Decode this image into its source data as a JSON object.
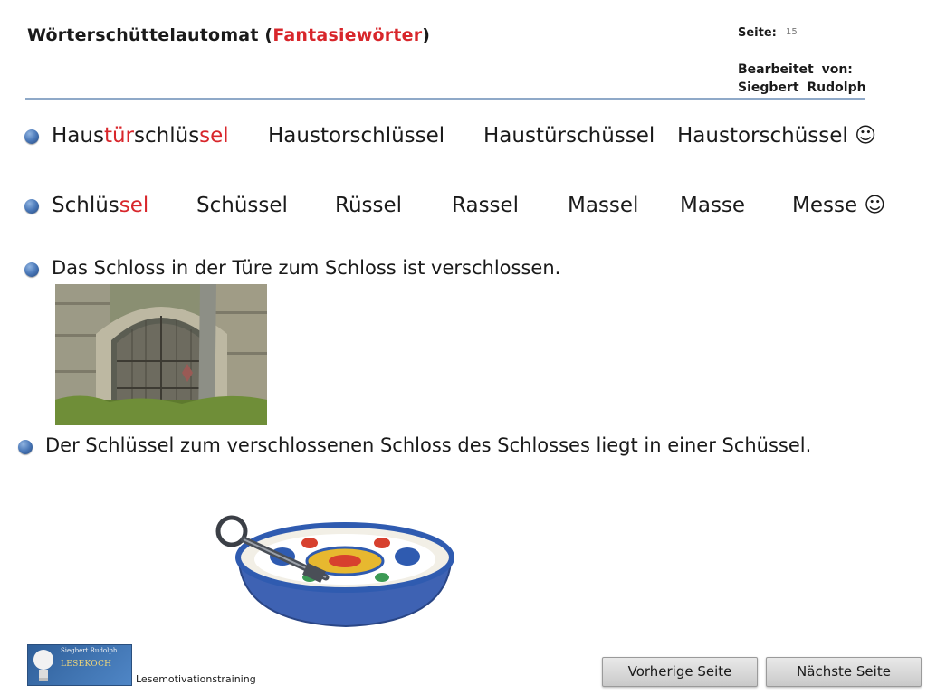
{
  "header": {
    "title_part1": "Wörterschüttelautomat (",
    "title_red": "Fantasiewörter",
    "title_part2": ")",
    "page_label": "Seite:",
    "page_number": "15",
    "edited_label": "Bearbeitet von:",
    "edited_name": "Siegbert Rudolph"
  },
  "row1": {
    "w1_a": "Haus",
    "w1_b": "tür",
    "w1_c": "schlüs",
    "w1_d": "sel",
    "w2": "Haustorschlüssel",
    "w3": "Haustürschüssel",
    "w4": "Haustorschüssel ☺"
  },
  "row2": {
    "w1_a": "Schlüs",
    "w1_b": "sel",
    "w2": "Schüssel",
    "w3": "Rüssel",
    "w4": "Rassel",
    "w5": "Massel",
    "w6": "Masse",
    "w7": "Messe ☺"
  },
  "sentence1": "Das Schloss in der Türe zum Schloss ist verschlossen.",
  "sentence2": "Der Schlüssel zum verschlossenen Schloss des Schlosses liegt in einer Schüssel.",
  "footer": {
    "logo_name": "Siegbert Rudolph",
    "logo_brand": "LESEKOCH",
    "caption": "Lesemotivationstraining",
    "prev_button": "Vorherige Seite",
    "next_button": "Nächste Seite"
  },
  "colors": {
    "accent_red": "#d8262b",
    "bullet_blue": "#4a78b8",
    "rule": "#8fa9c8"
  }
}
